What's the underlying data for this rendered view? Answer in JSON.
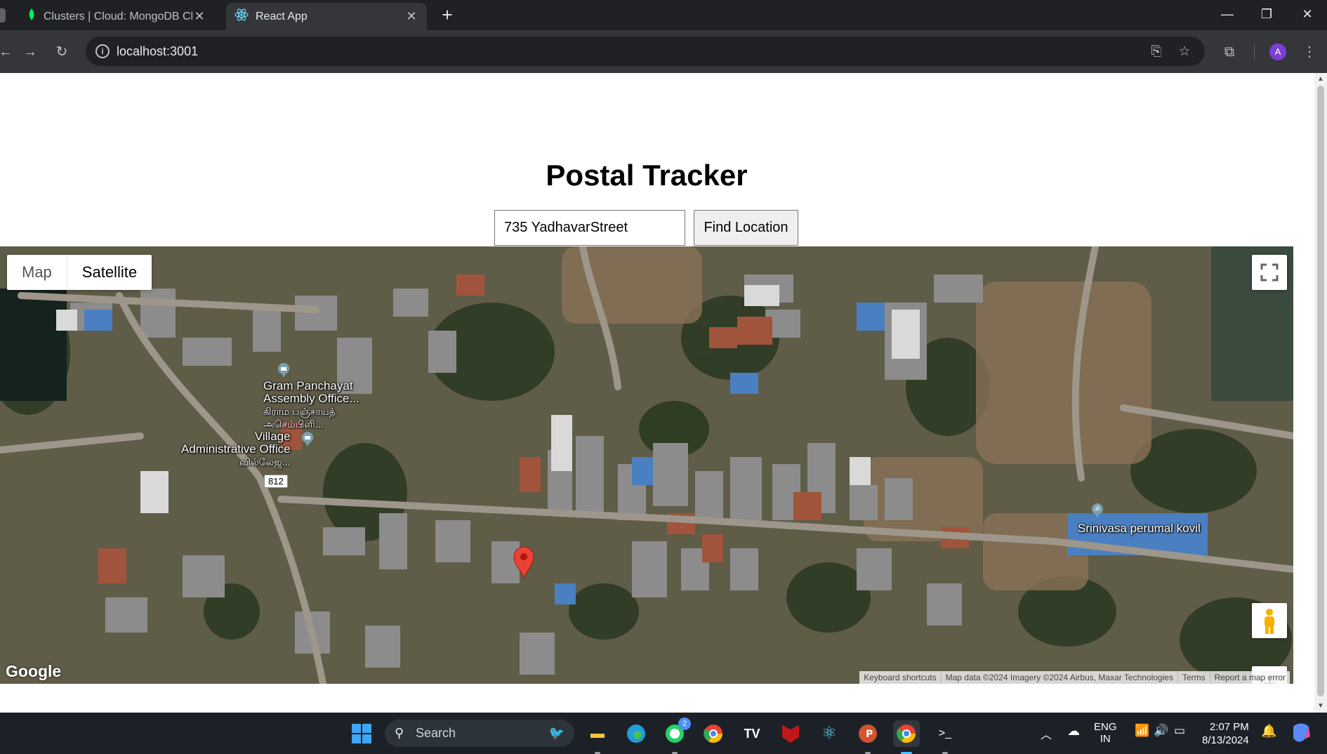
{
  "browser": {
    "tabs": [
      {
        "title": "Clusters | Cloud: MongoDB Clou",
        "icon": "mongodb-leaf-icon",
        "active": false
      },
      {
        "title": "React App",
        "icon": "react-icon",
        "active": true
      }
    ],
    "url": "localhost:3001",
    "avatar_letter": "A"
  },
  "page": {
    "title": "Postal Tracker",
    "input_value": "735 YadhavarStreet",
    "button_label": "Find Location"
  },
  "map": {
    "type_controls": {
      "map": "Map",
      "satellite": "Satellite",
      "selected": "Satellite"
    },
    "labels": {
      "gram_panchayat_en": "Gram Panchayat",
      "gram_panchayat_en2": "Assembly Office...",
      "gram_panchayat_ta": "கிராம பஞ்சாயத்",
      "gram_panchayat_ta2": "அசெம்பிளி...",
      "village_office_en": "Village",
      "village_office_en2": "Administrative Office",
      "village_office_ta": "வில்லேஜ...",
      "temple": "Srinivasa perumal kovil",
      "road_shield": "812"
    },
    "logo": "Google",
    "attribution": {
      "shortcuts": "Keyboard shortcuts",
      "data": "Map data ©2024 Imagery ©2024 Airbus, Maxar Technologies",
      "terms": "Terms",
      "report": "Report a map error"
    }
  },
  "taskbar": {
    "search_placeholder": "Search",
    "whatsapp_badge": "2",
    "language": "ENG",
    "region": "IN",
    "time": "2:07 PM",
    "date": "8/13/2024"
  },
  "colors": {
    "chrome_dark": "#202124",
    "chrome_toolbar": "#35363a",
    "marker_red": "#ea4335",
    "taskbar": "#1c2128"
  }
}
